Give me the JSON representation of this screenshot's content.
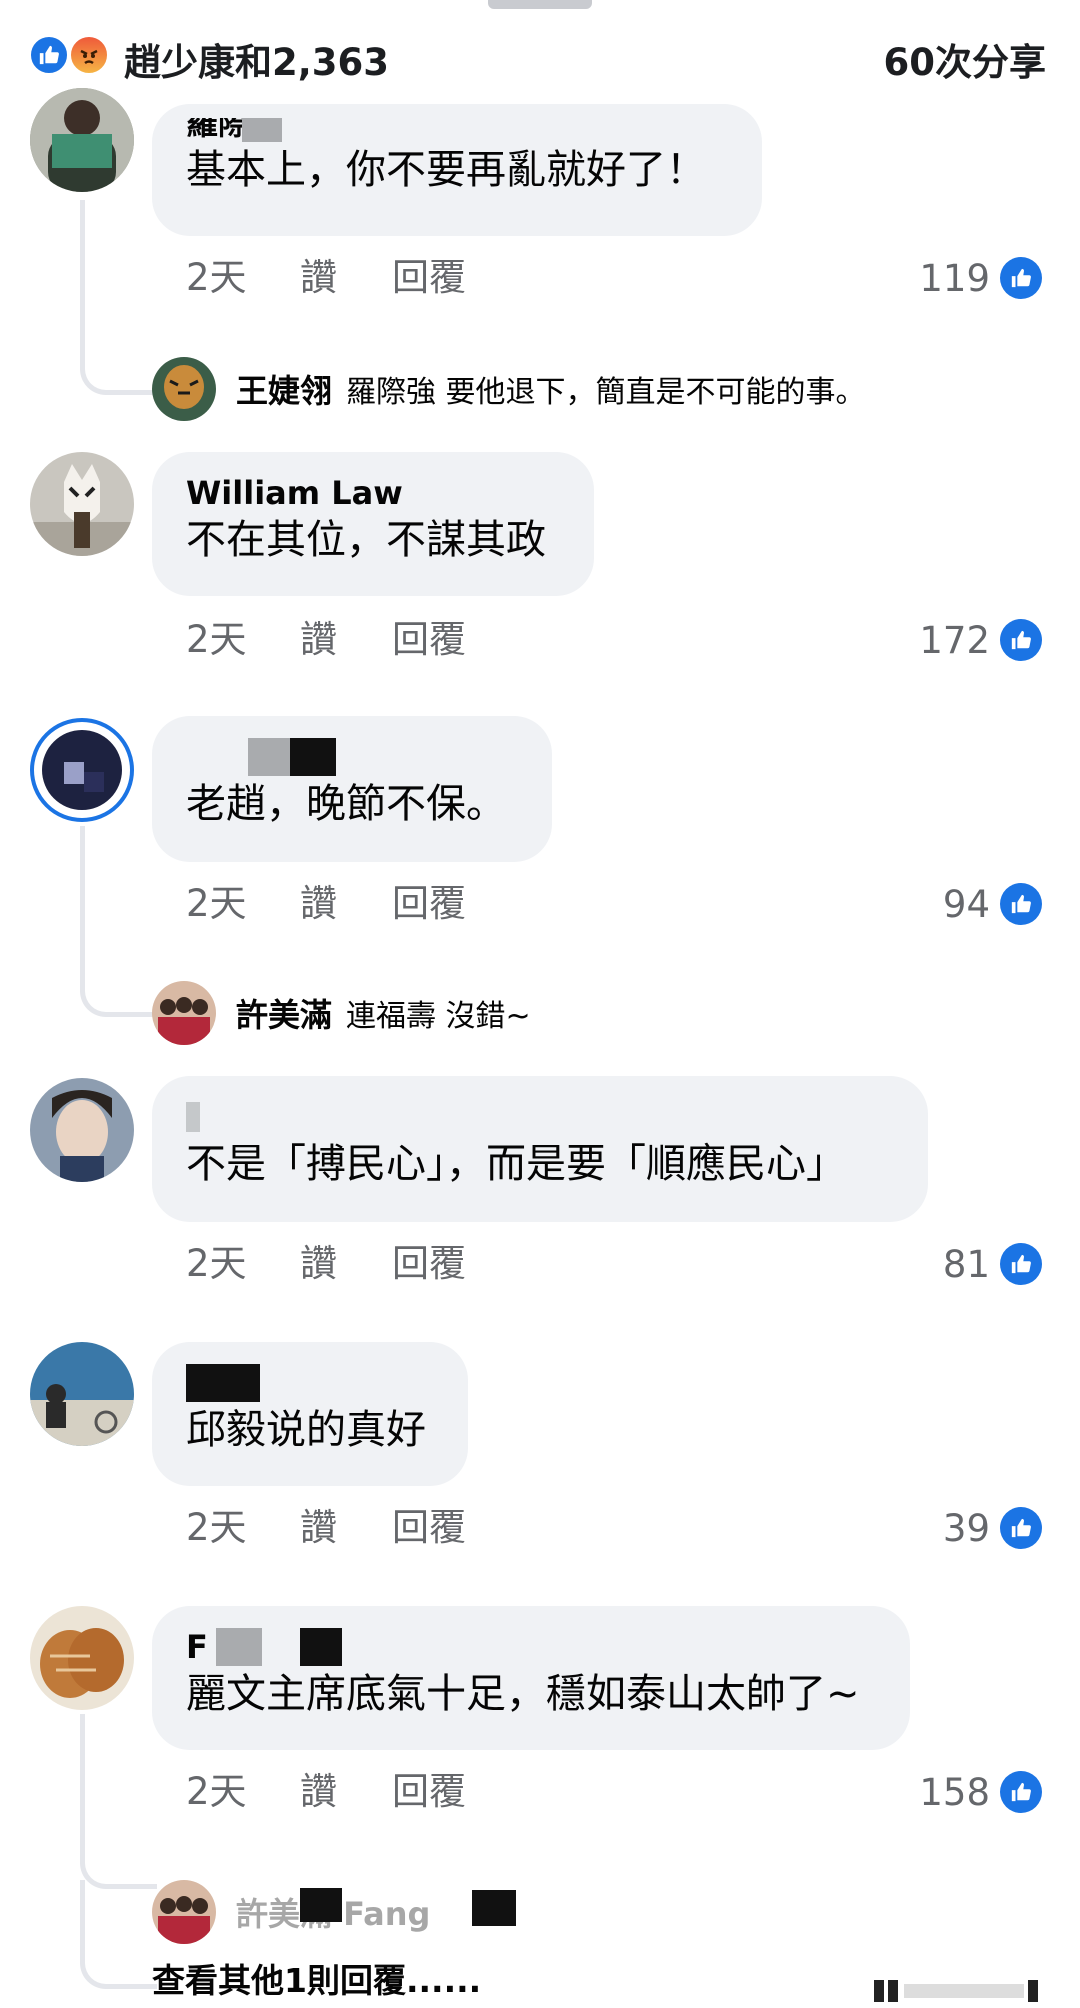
{
  "header": {
    "reaction_summary": "趙少康和2,363",
    "shares": "60次分享"
  },
  "comments": [
    {
      "author": "羅際強",
      "text": "基本上，你不要再亂就好了！",
      "time": "2天",
      "like": "讚",
      "reply": "回覆",
      "likes": "119",
      "replies": [
        {
          "name": "王婕翎",
          "text": "羅際強 要他退下，簡直是不可能的事。"
        }
      ]
    },
    {
      "author": "William Law",
      "text": "不在其位，不謀其政",
      "time": "2天",
      "like": "讚",
      "reply": "回覆",
      "likes": "172",
      "replies": []
    },
    {
      "author": "",
      "text": "老趙，晚節不保。",
      "time": "2天",
      "like": "讚",
      "reply": "回覆",
      "likes": "94",
      "replies": [
        {
          "name": "許美滿",
          "text": "連福壽 沒錯~"
        }
      ]
    },
    {
      "author": "",
      "text": "不是「搏民心」，而是要「順應民心」",
      "time": "2天",
      "like": "讚",
      "reply": "回覆",
      "likes": "81",
      "replies": []
    },
    {
      "author": "",
      "text": "邱毅说的真好",
      "time": "2天",
      "like": "讚",
      "reply": "回覆",
      "likes": "39",
      "replies": []
    },
    {
      "author": "F",
      "text": "麗文主席底氣十足，穩如泰山太帥了~",
      "time": "2天",
      "like": "讚",
      "reply": "回覆",
      "likes": "158",
      "replies": [
        {
          "name": "許美滿 Fang",
          "text": ""
        }
      ]
    }
  ],
  "more_replies": "查看其他1則回覆......",
  "colors": {
    "like_blue": "#1b74e4",
    "bubble": "#f0f2f5",
    "meta_grey": "#65676b"
  }
}
